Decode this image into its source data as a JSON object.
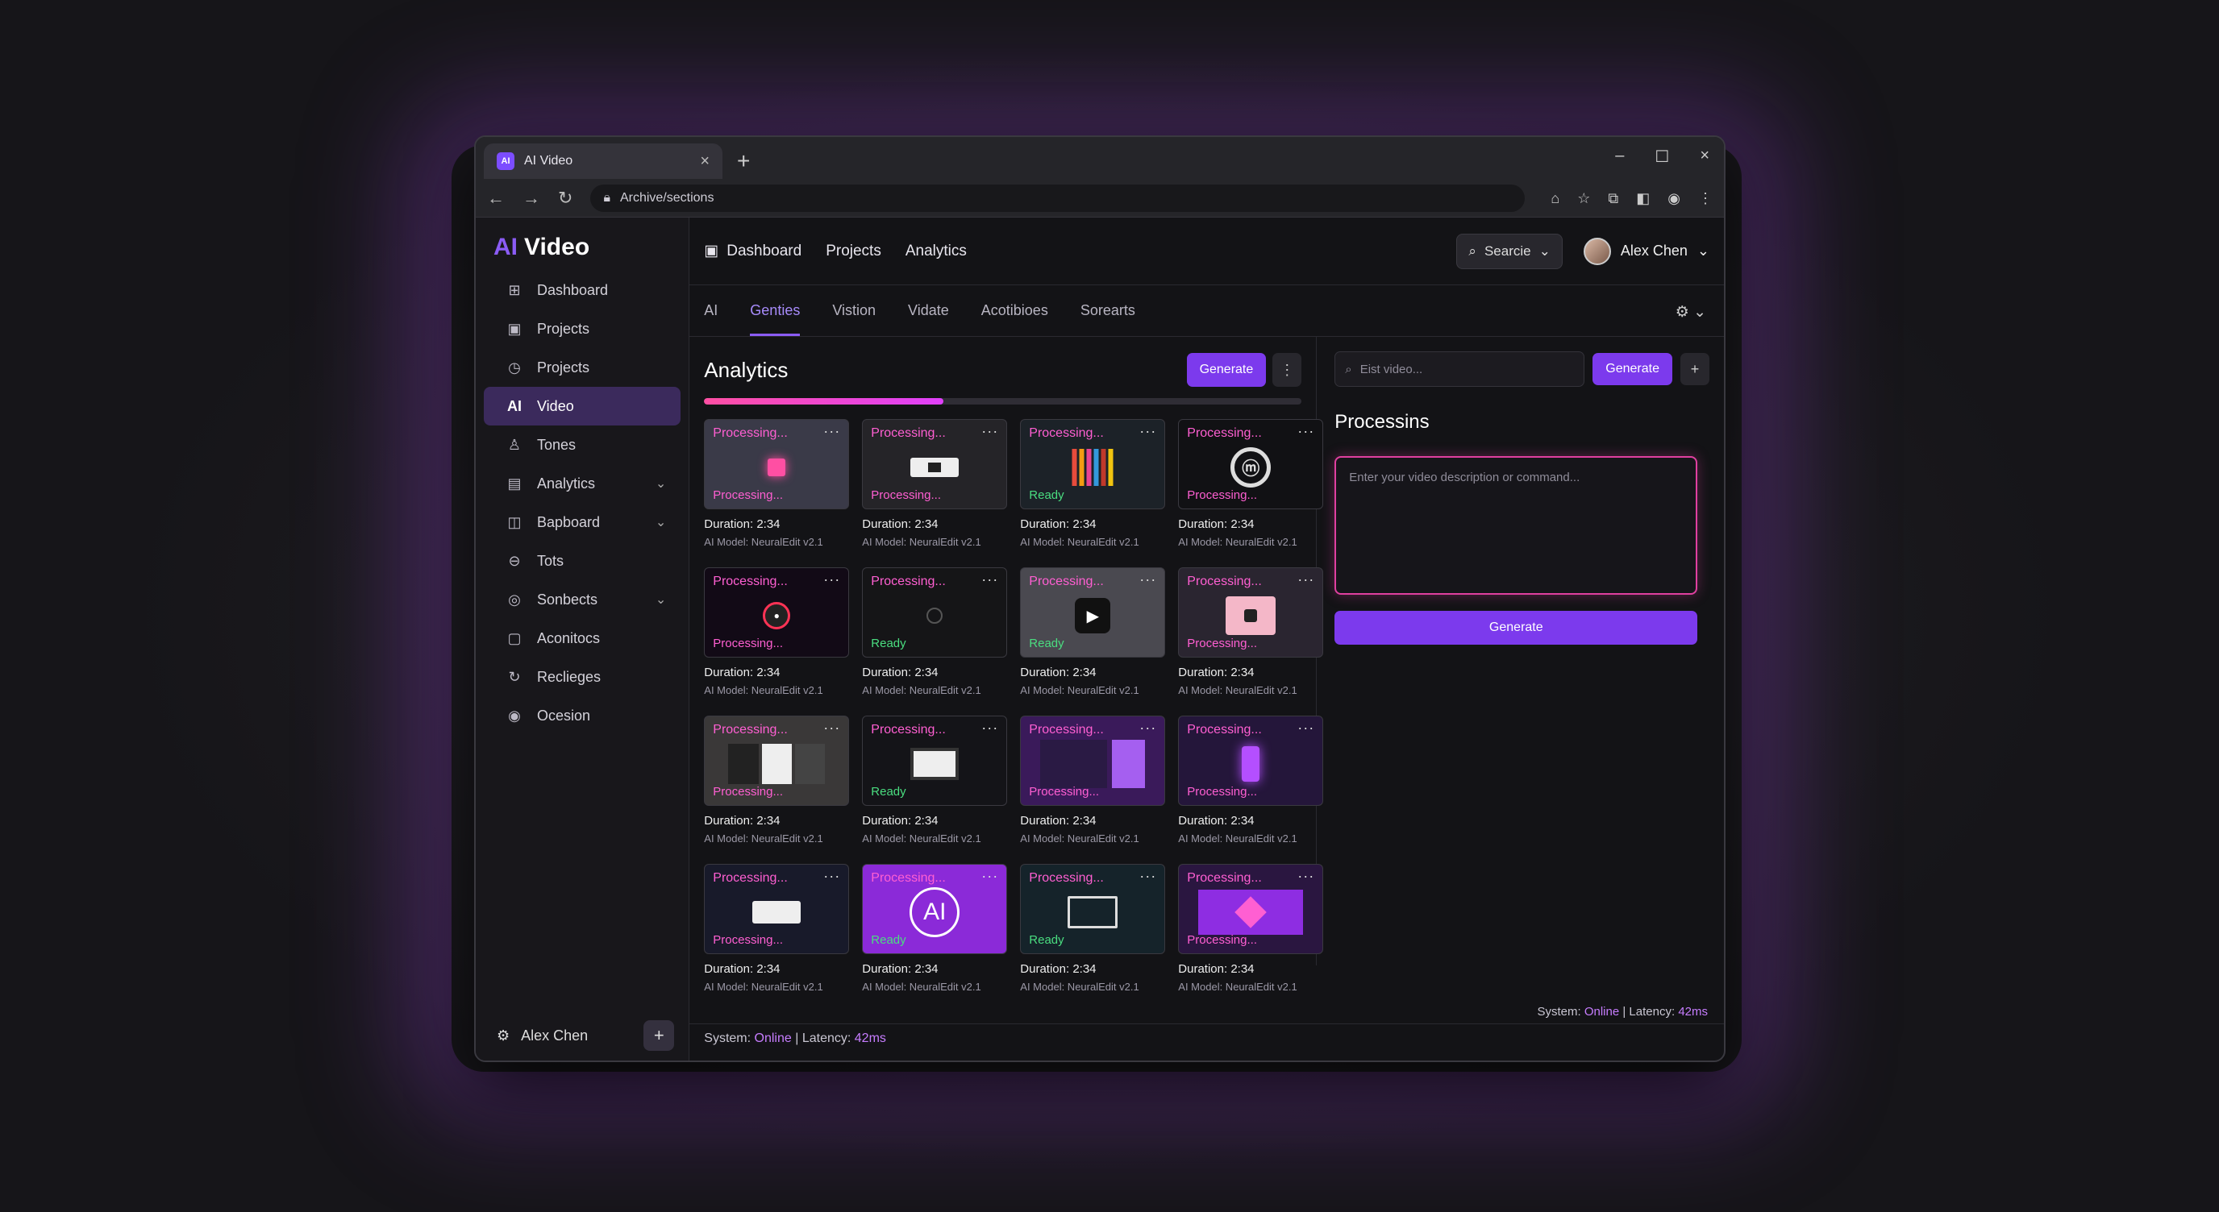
{
  "browser": {
    "tab_title": "AI Video",
    "favicon": "AI",
    "url": "Archive/sections",
    "window_controls": [
      "–",
      "☐",
      "×"
    ]
  },
  "sidebar": {
    "logo_ai": "AI",
    "logo_text": "Video",
    "items": [
      {
        "label": "Dashboard",
        "icon": "dashboard-icon",
        "glyph": "⊞"
      },
      {
        "label": "Projects",
        "icon": "folder-icon",
        "glyph": "▣"
      },
      {
        "label": "Projects",
        "icon": "clock-icon",
        "glyph": "◷"
      },
      {
        "label": "Video",
        "icon": "ai-icon",
        "glyph": "AI",
        "active": true
      },
      {
        "label": "Tones",
        "icon": "person-icon",
        "glyph": "♙"
      },
      {
        "label": "Analytics",
        "icon": "chart-icon",
        "glyph": "▤",
        "chevron": true
      },
      {
        "label": "Bapboard",
        "icon": "board-icon",
        "glyph": "◫",
        "chevron": true
      },
      {
        "label": "Tots",
        "icon": "circle-minus-icon",
        "glyph": "⊖"
      },
      {
        "label": "Sonbects",
        "icon": "globe-icon",
        "glyph": "◎",
        "chevron": true
      },
      {
        "label": "Aconitocs",
        "icon": "box-icon",
        "glyph": "▢"
      },
      {
        "label": "Reclieges",
        "icon": "refresh-icon",
        "glyph": "↻"
      },
      {
        "label": "Ocesion",
        "icon": "check-circle-icon",
        "glyph": "◉"
      }
    ],
    "footer_user": "Alex Chen",
    "footer_plus": "+"
  },
  "topnav": {
    "items": [
      "Dashboard",
      "Projects",
      "Analytics"
    ],
    "search_label": "Searcie",
    "user_name": "Alex Chen"
  },
  "subtabs": [
    "AI",
    "Genties",
    "Vistion",
    "Vidate",
    "Acotibioes",
    "Sorearts"
  ],
  "left": {
    "title": "Analytics",
    "generate_label": "Generate",
    "progress": 0.4,
    "cards": [
      {
        "status": "Processing...",
        "status2": "Processing...",
        "ready": false,
        "bg": "#3a3a48",
        "pic": "pink-square"
      },
      {
        "status": "Processing...",
        "status2": "Processing...",
        "ready": false,
        "bg": "#252428",
        "pic": "white-card"
      },
      {
        "status": "Processing...",
        "status2": "Ready",
        "ready": true,
        "bg": "#1c2228",
        "pic": "books"
      },
      {
        "status": "Processing...",
        "status2": "Processing...",
        "ready": false,
        "bg": "#111114",
        "pic": "logo-circle"
      },
      {
        "status": "Processing...",
        "status2": "Processing...",
        "ready": false,
        "bg": "#120a16",
        "pic": "play-pink"
      },
      {
        "status": "Processing...",
        "status2": "Ready",
        "ready": true,
        "bg": "#151517",
        "pic": "dim-circle"
      },
      {
        "status": "Processing...",
        "status2": "Ready",
        "ready": true,
        "bg": "#4a4950",
        "pic": "play-dark"
      },
      {
        "status": "Processing...",
        "status2": "Processing...",
        "ready": false,
        "bg": "#2a2530",
        "pic": "pink-box"
      },
      {
        "status": "Processing...",
        "status2": "Processing...",
        "ready": false,
        "bg": "#3a3838",
        "pic": "ui-panels"
      },
      {
        "status": "Processing...",
        "status2": "Ready",
        "ready": true,
        "bg": "#141418",
        "pic": "ui-dark"
      },
      {
        "status": "Processing...",
        "status2": "Processing...",
        "ready": false,
        "bg": "#3a1a5a",
        "pic": "purple-ui"
      },
      {
        "status": "Processing...",
        "status2": "Processing...",
        "ready": false,
        "bg": "#24163a",
        "pic": "phone"
      },
      {
        "status": "Processing...",
        "status2": "Processing...",
        "ready": false,
        "bg": "#181a2a",
        "pic": "dialog"
      },
      {
        "status": "Processing...",
        "status2": "Ready",
        "ready": true,
        "bg": "#8b2ad8",
        "pic": "ai-circle"
      },
      {
        "status": "Processing...",
        "status2": "Ready",
        "ready": true,
        "bg": "#15232a",
        "pic": "monitor"
      },
      {
        "status": "Processing...",
        "status2": "Processing...",
        "ready": false,
        "bg": "#2a1640",
        "pic": "purple-screen"
      }
    ],
    "duration": "Duration: 2:34",
    "model": "AI Model: NeuralEdit v2.1"
  },
  "right": {
    "search_placeholder": "Eist video...",
    "generate_label": "Generate",
    "plus": "+",
    "title": "Processins",
    "prompt_placeholder": "Enter your video description or command...",
    "big_button": "Generate"
  },
  "status": {
    "system_label": "System:",
    "online": "Online",
    "latency_label": "| Latency:",
    "latency": "42ms"
  }
}
